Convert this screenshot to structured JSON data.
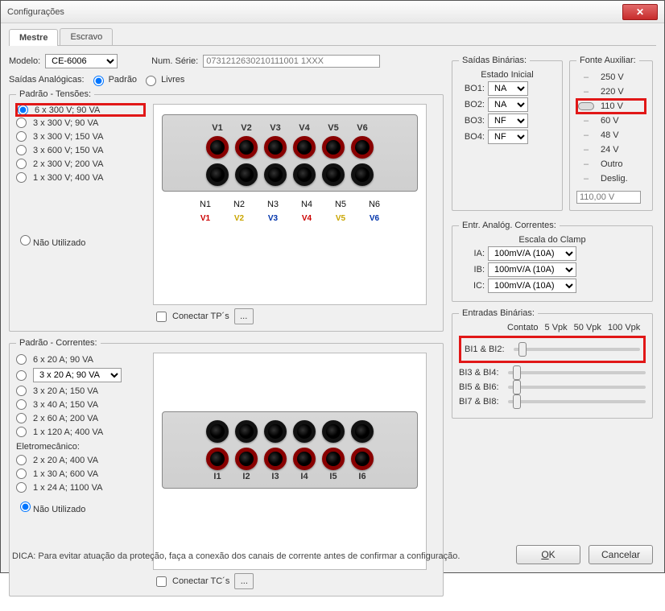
{
  "title": "Configurações",
  "tabs": {
    "mestre": "Mestre",
    "escravo": "Escravo"
  },
  "modelo": {
    "label": "Modelo:",
    "value": "CE-6006"
  },
  "numserie": {
    "label": "Num. Série:",
    "value": "0731212630210111001 1XXX"
  },
  "saidas_analog": {
    "label": "Saídas Analógicas:",
    "padrao": "Padrão",
    "livres": "Livres"
  },
  "padr_tensoes": {
    "legend": "Padrão - Tensões:",
    "options": [
      "6 x 300 V; 90 VA",
      "3 x 300 V; 90 VA",
      "3 x 300 V; 150 VA",
      "3 x 600 V; 150 VA",
      "2 x 300 V; 200 VA",
      "1 x 300 V; 400 VA"
    ],
    "nao_utilizado": "Não Utilizado"
  },
  "voltage_labels": [
    "V1",
    "V2",
    "V3",
    "V4",
    "V5",
    "V6"
  ],
  "neutral_labels": [
    "N1",
    "N2",
    "N3",
    "N4",
    "N5",
    "N6"
  ],
  "wire_colors": [
    "c-red",
    "c-yellow",
    "c-blue",
    "c-red",
    "c-yellow",
    "c-blue"
  ],
  "conectar_tp": "Conectar TP´s",
  "padr_correntes": {
    "legend": "Padrão - Correntes:",
    "options": [
      "6 x 20 A; 90 VA",
      "3 x 20 A; 90 VA",
      "3 x 20 A; 150 VA",
      "3 x 40 A; 150 VA",
      "2 x 60 A; 200 VA",
      "1 x 120 A; 400 VA"
    ],
    "eletro_label": "Eletromecânico:",
    "eletro_options": [
      "2 x 20 A; 400 VA",
      "1 x 30 A; 600 VA",
      "1 x 24 A; 1100 VA"
    ],
    "nao_utilizado": "Não Utilizado"
  },
  "current_labels": [
    "I1",
    "I2",
    "I3",
    "I4",
    "I5",
    "I6"
  ],
  "conectar_tc": "Conectar TC´s",
  "saidas_bin": {
    "legend": "Saídas Binárias:",
    "estado": "Estado Inicial",
    "rows": [
      {
        "k": "BO1:",
        "v": "NA"
      },
      {
        "k": "BO2:",
        "v": "NA"
      },
      {
        "k": "BO3:",
        "v": "NF"
      },
      {
        "k": "BO4:",
        "v": "NF"
      }
    ]
  },
  "entr_analog": {
    "legend": "Entr. Analóg. Correntes:",
    "escala": "Escala do Clamp",
    "rows": [
      {
        "k": "IA:",
        "v": "100mV/A (10A)"
      },
      {
        "k": "IB:",
        "v": "100mV/A (10A)"
      },
      {
        "k": "IC:",
        "v": "100mV/A (10A)"
      }
    ]
  },
  "entr_bin": {
    "legend": "Entradas Binárias:",
    "head": [
      "Contato",
      "5 Vpk",
      "50 Vpk",
      "100 Vpk"
    ],
    "rows": [
      "BI1 & BI2:",
      "BI3 & BI4:",
      "BI5 & BI6:",
      "BI7 & BI8:"
    ]
  },
  "fonte_aux": {
    "legend": "Fonte Auxiliar:",
    "options": [
      "250 V",
      "220 V",
      "110 V",
      "60 V",
      "48 V",
      "24 V",
      "Outro",
      "Deslig."
    ],
    "value": "110,00 V"
  },
  "hint": "DICA: Para evitar atuação da proteção, faça a conexão dos canais de corrente antes de confirmar a configuração.",
  "buttons": {
    "ok": "OK",
    "cancel": "Cancelar"
  }
}
